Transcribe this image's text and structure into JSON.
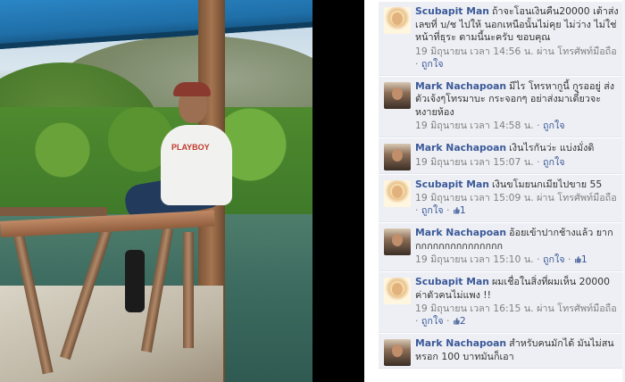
{
  "comments": [
    {
      "author": "Scubapit Man",
      "text": "ถ้าจะโอนเงินคืน20000 เต้าส่งเลขที่ บ/ช ไปให้ นอกเหนือนั้นไม่คุย ไม่ว่าง ไม่ใช่หน้าที่ธุระ ตามนี้นะครับ ขอบคุณ",
      "time": "19 มิถุนายน เวลา 14:56 น.",
      "via": "ผ่าน โทรศัพท์มือถือ",
      "like": "ถูกใจ",
      "likes": ""
    },
    {
      "author": "Mark Nachapoan",
      "text": "มีไร โทรหากูนี้ กูรออยู่ ส่งตัวเจ้งๆโทรมาบะ กระจอกๆ อย่าส่งมาเดี๋ยวจะหงายห้อง",
      "time": "19 มิถุนายน เวลา 14:58 น.",
      "via": "",
      "like": "ถูกใจ",
      "likes": ""
    },
    {
      "author": "Mark Nachapoan",
      "text": "เงินไรกันว่ะ แบ่งมั่งดิ",
      "time": "19 มิถุนายน เวลา 15:07 น.",
      "via": "",
      "like": "ถูกใจ",
      "likes": ""
    },
    {
      "author": "Scubapit Man",
      "text": "เงินขโมยนกเมียไปขาย 55",
      "time": "19 มิถุนายน เวลา 15:09 น.",
      "via": "ผ่าน โทรศัพท์มือถือ",
      "like": "ถูกใจ",
      "likes": "1"
    },
    {
      "author": "Mark Nachapoan",
      "text": "อ้อยเข้าปากช้างแล้ว ยากกกกกกกกกกกกกกกก",
      "time": "19 มิถุนายน เวลา 15:10 น.",
      "via": "",
      "like": "ถูกใจ",
      "likes": "1"
    },
    {
      "author": "Scubapit Man",
      "text": "ผมเชื่อในสิ่งที่ผมเห็น 20000 ค่าตัวคนไม่แพง !!",
      "time": "19 มิถุนายน เวลา 16:15 น.",
      "via": "ผ่าน โทรศัพท์มือถือ",
      "like": "ถูกใจ",
      "likes": "2"
    },
    {
      "author": "Mark Nachapoan",
      "text": "สำหรับคนมักได้ มันไม่สนหรอก 100 บาทมันก็เอา",
      "time": "",
      "via": "",
      "like": "",
      "likes": ""
    }
  ],
  "photo": {
    "shirt_text": "PLAYBOY"
  },
  "colors": {
    "link": "#3b5998",
    "comment_bg": "#edeff4",
    "meta": "#808080"
  }
}
